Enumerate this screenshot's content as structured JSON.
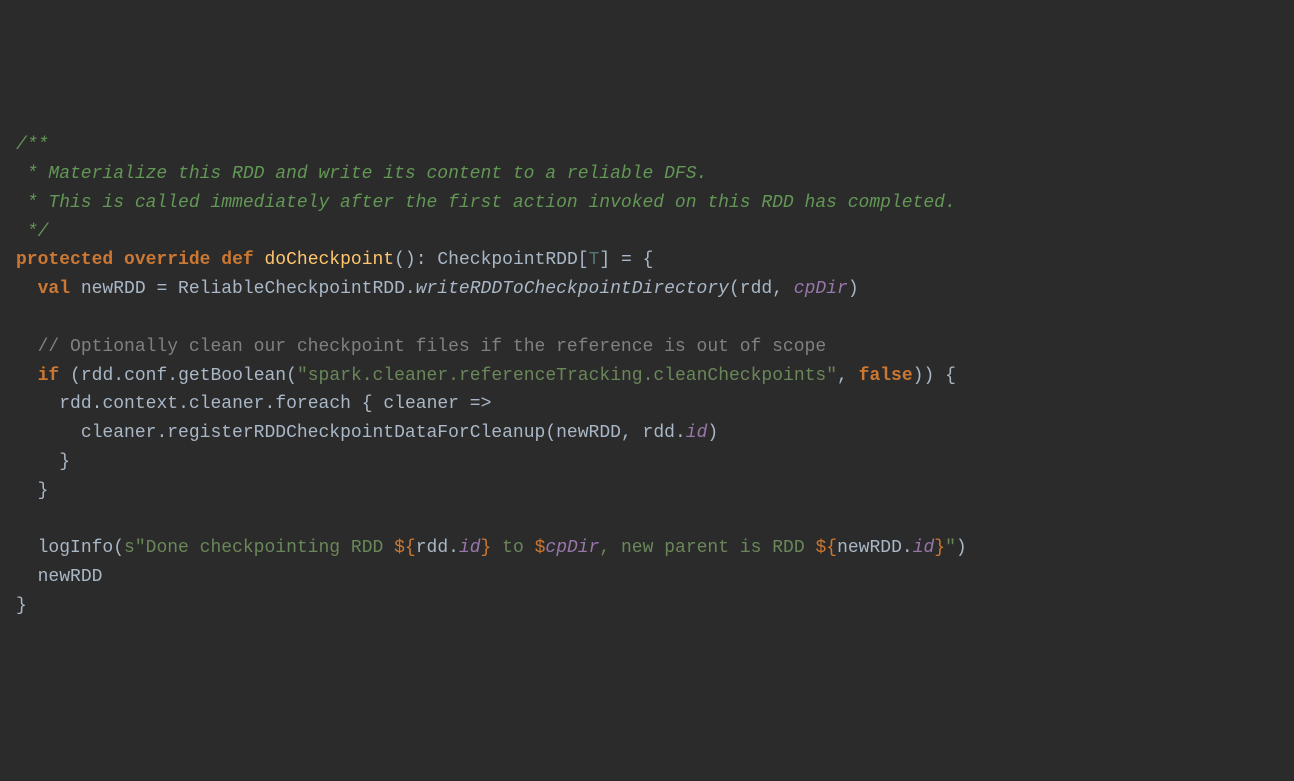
{
  "code": {
    "doc": {
      "start": "/**",
      "line1": " * Materialize this RDD and write its content to a reliable DFS.",
      "line2": " * This is called immediately after the first action invoked on this RDD has completed.",
      "end": " */"
    },
    "kw": {
      "protected": "protected",
      "override": "override",
      "def": "def",
      "val": "val",
      "if": "if",
      "false": "false"
    },
    "method": {
      "doCheckpoint": "doCheckpoint",
      "writeRDDToCheckpointDirectory": "writeRDDToCheckpointDirectory",
      "getBoolean": "getBoolean",
      "foreach": "foreach",
      "registerRDDCheckpointDataForCleanup": "registerRDDCheckpointDataForCleanup",
      "logInfo": "logInfo"
    },
    "type": {
      "CheckpointRDD": "CheckpointRDD",
      "T": "T",
      "ReliableCheckpointRDD": "ReliableCheckpointRDD"
    },
    "ident": {
      "newRDD": "newRDD",
      "rdd": "rdd",
      "cpDir": "cpDir",
      "conf": "conf",
      "context": "context",
      "cleaner": "cleaner",
      "id": "id"
    },
    "string": {
      "configKey": "\"spark.cleaner.referenceTracking.cleanCheckpoints\"",
      "sQuoteStart": "s\"",
      "logPart1": "Done checkpointing RDD ",
      "logPart2": " to ",
      "logPart3": ", new parent is RDD ",
      "quoteEnd": "\""
    },
    "comment": {
      "optional": "// Optionally clean our checkpoint files if the reference is out of scope"
    },
    "punct": {
      "parenOpen": "(",
      "parenClose": ")",
      "colon": ":",
      "braceOpen": "{",
      "braceClose": "}",
      "bracketOpen": "[",
      "bracketClose": "]",
      "equals": " = ",
      "dot": ".",
      "comma": ", ",
      "arrow": " =>",
      "doubleParenClose": "))",
      "space": " ",
      "dollarBraceOpen": "${",
      "dollar": "$",
      "parenCloseSpace": ") "
    }
  }
}
